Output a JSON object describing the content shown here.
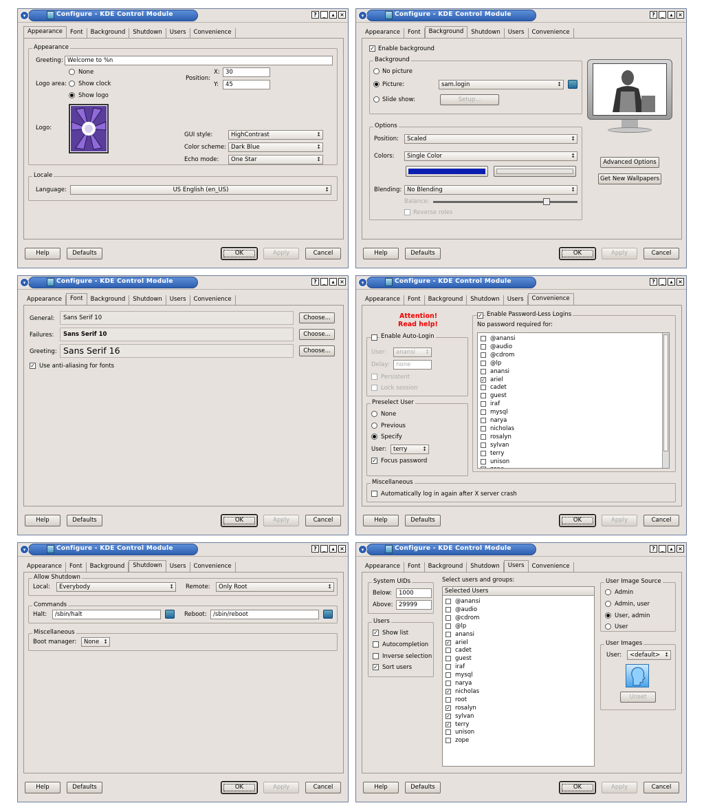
{
  "window_title": "Configure - KDE Control Module",
  "tabs": [
    "Appearance",
    "Font",
    "Background",
    "Shutdown",
    "Users",
    "Convenience"
  ],
  "buttons": {
    "help": "Help",
    "defaults": "Defaults",
    "ok": "OK",
    "apply": "Apply",
    "cancel": "Cancel"
  },
  "appearance": {
    "group_appearance": "Appearance",
    "greeting_label": "Greeting:",
    "greeting_value": "Welcome to %n",
    "logo_area_label": "Logo area:",
    "radio_none": "None",
    "radio_clock": "Show clock",
    "radio_logo": "Show logo",
    "position_label": "Position:",
    "x_label": "X:",
    "x_value": "30",
    "y_label": "Y:",
    "y_value": "45",
    "logo_label": "Logo:",
    "gui_style_label": "GUI style:",
    "gui_style_value": "HighContrast",
    "color_scheme_label": "Color scheme:",
    "color_scheme_value": "Dark Blue",
    "echo_mode_label": "Echo mode:",
    "echo_mode_value": "One Star",
    "group_locale": "Locale",
    "language_label": "Language:",
    "language_value": "US English (en_US)"
  },
  "background": {
    "enable_label": "Enable background",
    "group_background": "Background",
    "no_picture": "No picture",
    "picture_label": "Picture:",
    "picture_value": "sam.login",
    "slide_show": "Slide show:",
    "setup": "Setup...",
    "group_options": "Options",
    "position_label": "Position:",
    "position_value": "Scaled",
    "colors_label": "Colors:",
    "colors_value": "Single Color",
    "blending_label": "Blending:",
    "blending_value": "No Blending",
    "balance_label": "Balance:",
    "reverse_roles": "Reverse roles",
    "advanced": "Advanced Options",
    "new_wallpapers": "Get New Wallpapers",
    "primary_color": "#0a1fb0",
    "balance_value": 0.8
  },
  "font": {
    "general_label": "General:",
    "general_value": "Sans Serif 10",
    "failures_label": "Failures:",
    "failures_value": "Sans Serif 10",
    "greeting_label": "Greeting:",
    "greeting_value": "Sans Serif 16",
    "choose": "Choose...",
    "antialias": "Use anti-aliasing for fonts"
  },
  "convenience": {
    "attention": "Attention!",
    "read_help": "Read help!",
    "autologin_group": "Enable Auto-Login",
    "user_label": "User:",
    "user_value": "anansi",
    "delay_label": "Delay:",
    "delay_value": "none",
    "persistent": "Persistent",
    "lock_session": "Lock session",
    "preselect_group": "Preselect User",
    "none": "None",
    "previous": "Previous",
    "specify": "Specify",
    "preselect_user_label": "User:",
    "preselect_user_value": "terry",
    "focus_password": "Focus password",
    "pwless_group": "Enable Password-Less Logins",
    "no_password_label": "No password required for:",
    "users": [
      {
        "name": "@anansi",
        "checked": false
      },
      {
        "name": "@audio",
        "checked": false
      },
      {
        "name": "@cdrom",
        "checked": false
      },
      {
        "name": "@lp",
        "checked": false
      },
      {
        "name": "anansi",
        "checked": false
      },
      {
        "name": "ariel",
        "checked": true
      },
      {
        "name": "cadet",
        "checked": false
      },
      {
        "name": "guest",
        "checked": false
      },
      {
        "name": "iraf",
        "checked": false
      },
      {
        "name": "mysql",
        "checked": false
      },
      {
        "name": "narya",
        "checked": false
      },
      {
        "name": "nicholas",
        "checked": false
      },
      {
        "name": "rosalyn",
        "checked": false
      },
      {
        "name": "sylvan",
        "checked": false
      },
      {
        "name": "terry",
        "checked": false
      },
      {
        "name": "unison",
        "checked": false
      },
      {
        "name": "zope",
        "checked": false
      }
    ],
    "misc_group": "Miscellaneous",
    "auto_relogin": "Automatically log in again after X server crash"
  },
  "shutdown": {
    "allow_group": "Allow Shutdown",
    "local_label": "Local:",
    "local_value": "Everybody",
    "remote_label": "Remote:",
    "remote_value": "Only Root",
    "commands_group": "Commands",
    "halt_label": "Halt:",
    "halt_value": "/sbin/halt",
    "reboot_label": "Reboot:",
    "reboot_value": "/sbin/reboot",
    "misc_group": "Miscellaneous",
    "boot_manager_label": "Boot manager:",
    "boot_manager_value": "None"
  },
  "users": {
    "uids_group": "System UIDs",
    "below_label": "Below:",
    "below_value": "1000",
    "above_label": "Above:",
    "above_value": "29999",
    "select_label": "Select users and groups:",
    "selected_header": "Selected Users",
    "users_group": "Users",
    "show_list": "Show list",
    "autocompletion": "Autocompletion",
    "inverse": "Inverse selection",
    "sort": "Sort users",
    "source_group": "User Image Source",
    "admin": "Admin",
    "admin_user": "Admin, user",
    "user_admin": "User, admin",
    "user": "User",
    "images_group": "User Images",
    "image_user_label": "User:",
    "image_user_value": "<default>",
    "unset": "Unset",
    "list": [
      {
        "name": "@anansi",
        "checked": false
      },
      {
        "name": "@audio",
        "checked": false
      },
      {
        "name": "@cdrom",
        "checked": false
      },
      {
        "name": "@lp",
        "checked": false
      },
      {
        "name": "anansi",
        "checked": false
      },
      {
        "name": "ariel",
        "checked": true
      },
      {
        "name": "cadet",
        "checked": false
      },
      {
        "name": "guest",
        "checked": false
      },
      {
        "name": "iraf",
        "checked": false
      },
      {
        "name": "mysql",
        "checked": false
      },
      {
        "name": "narya",
        "checked": false
      },
      {
        "name": "nicholas",
        "checked": true
      },
      {
        "name": "root",
        "checked": false
      },
      {
        "name": "rosalyn",
        "checked": true
      },
      {
        "name": "sylvan",
        "checked": true
      },
      {
        "name": "terry",
        "checked": true
      },
      {
        "name": "unison",
        "checked": false
      },
      {
        "name": "zope",
        "checked": false
      }
    ]
  }
}
